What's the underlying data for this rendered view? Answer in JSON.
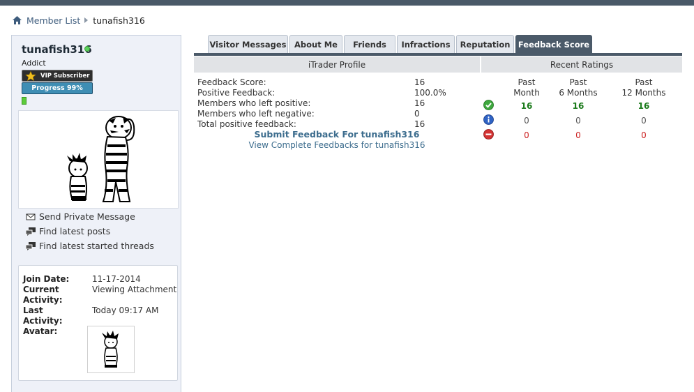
{
  "breadcrumb": {
    "member_list": "Member List",
    "current": "tunafish316"
  },
  "profile": {
    "username": "tunafish316",
    "rank": "Addict",
    "vip_badge": "VIP Subscriber",
    "progress_badge": "Progress 99%",
    "actions": [
      {
        "label": "Send Private Message",
        "icon": "envelope-icon"
      },
      {
        "label": "Find latest posts",
        "icon": "posts-icon"
      },
      {
        "label": "Find latest started threads",
        "icon": "threads-icon"
      }
    ],
    "info": {
      "join_date_label": "Join Date:",
      "join_date": "11-17-2014",
      "current_activity_label": "Current Activity:",
      "current_activity": "Viewing Attachment",
      "last_activity_label": "Last Activity:",
      "last_activity": "Today 09:17 AM",
      "avatar_label": "Avatar:"
    }
  },
  "tabs": [
    {
      "label": "Visitor Messages",
      "active": false
    },
    {
      "label": "About Me",
      "active": false
    },
    {
      "label": "Friends",
      "active": false
    },
    {
      "label": "Infractions",
      "active": false
    },
    {
      "label": "Reputation",
      "active": false
    },
    {
      "label": "Feedback Score",
      "active": true
    }
  ],
  "itrader": {
    "header": "iTrader Profile",
    "rows": [
      {
        "label": "Feedback Score:",
        "value": "16"
      },
      {
        "label": "Positive Feedback:",
        "value": "100.0%"
      },
      {
        "label": "Members who left positive:",
        "value": "16"
      },
      {
        "label": "Members who left negative:",
        "value": "0"
      },
      {
        "label": "Total positive feedback:",
        "value": "16"
      }
    ],
    "submit_link": "Submit Feedback For tunafish316",
    "view_link": "View Complete Feedbacks for tunafish316"
  },
  "recent": {
    "header": "Recent Ratings",
    "columns": [
      {
        "line1": "Past",
        "line2": "Month"
      },
      {
        "line1": "Past",
        "line2": "6 Months"
      },
      {
        "line1": "Past",
        "line2": "12 Months"
      }
    ],
    "rows": [
      {
        "type": "positive",
        "icon": "check-icon",
        "values": [
          "16",
          "16",
          "16"
        ]
      },
      {
        "type": "neutral",
        "icon": "info-icon",
        "values": [
          "0",
          "0",
          "0"
        ]
      },
      {
        "type": "negative",
        "icon": "minus-icon",
        "values": [
          "0",
          "0",
          "0"
        ]
      }
    ]
  },
  "colors": {
    "accent": "#4b5a69",
    "link": "#3e5c7d",
    "positive": "#1a7a1a",
    "negative": "#cc2222"
  }
}
